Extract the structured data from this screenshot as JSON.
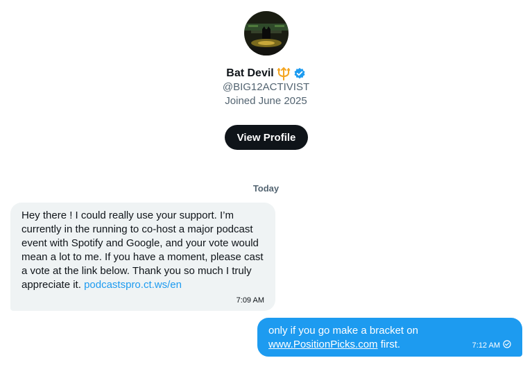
{
  "profile": {
    "display_name": "Bat Devil",
    "name_emoji_icon": "trident-icon",
    "verified_icon": "verified-badge-icon",
    "handle": "@BIG12ACTIVIST",
    "joined": "Joined June 2025",
    "view_profile_label": "View Profile"
  },
  "conversation": {
    "date_divider": "Today",
    "messages": [
      {
        "direction": "received",
        "text": "Hey there ! I could really use your support. I’m currently in the running to co-host a major podcast event with Spotify and Google, and your vote would mean a lot to me. If you have a moment, please cast a vote at the link below. Thank you so much I truly appreciate it.",
        "link_text": "podcastspro.ct.ws/en",
        "time": "7:09 AM"
      },
      {
        "direction": "sent",
        "text_before": "only if you go make a bracket on",
        "link_text": "www.PositionPicks.com",
        "text_after": " first.",
        "time": "7:12 AM",
        "status_icon": "read-check-icon"
      }
    ]
  },
  "colors": {
    "accent": "#1d9bf0",
    "text_primary": "#0f1419",
    "text_secondary": "#536471",
    "received_bubble": "#eff3f4",
    "button_bg": "#0f1419",
    "emoji": "#f4a623"
  }
}
